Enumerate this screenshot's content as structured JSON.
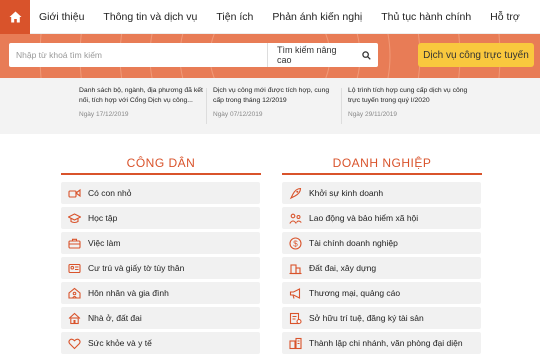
{
  "nav": {
    "items": [
      "Giới thiệu",
      "Thông tin và dịch vụ",
      "Tiện ích",
      "Phản ánh kiến nghị",
      "Thủ tục hành chính",
      "Hỗ trợ"
    ]
  },
  "search": {
    "placeholder": "Nhập từ khoá tìm kiếm",
    "advanced_label": "Tìm kiếm nâng cao",
    "cta_label": "Dịch vụ công trực tuyến"
  },
  "news": [
    {
      "title": "Danh sách bộ, ngành, địa phương đã kết nối, tích hợp với Cổng Dịch vụ công...",
      "date": "Ngày 17/12/2019"
    },
    {
      "title": "Dịch vụ công mới được tích hợp, cung cấp trong tháng 12/2019",
      "date": "Ngày 07/12/2019"
    },
    {
      "title": "Lộ trình tích hợp cung cấp dịch vụ công trực tuyến trong quý I/2020",
      "date": "Ngày 29/11/2019"
    }
  ],
  "sections": {
    "cong_dan": {
      "title": "CÔNG DÂN",
      "items": [
        {
          "label": "Có con nhỏ",
          "icon": "baby-icon"
        },
        {
          "label": "Học tập",
          "icon": "graduation-cap-icon"
        },
        {
          "label": "Việc làm",
          "icon": "briefcase-icon"
        },
        {
          "label": "Cư trú và giấy tờ tùy thân",
          "icon": "id-card-icon"
        },
        {
          "label": "Hôn nhân và gia đình",
          "icon": "family-icon"
        },
        {
          "label": "Nhà ở, đất đai",
          "icon": "house-icon"
        },
        {
          "label": "Sức khỏe và y tế",
          "icon": "health-icon"
        }
      ]
    },
    "doanh_nghiep": {
      "title": "DOANH NGHIỆP",
      "items": [
        {
          "label": "Khởi sự kinh doanh",
          "icon": "rocket-icon"
        },
        {
          "label": "Lao động và bảo hiểm xã hội",
          "icon": "workers-icon"
        },
        {
          "label": "Tài chính doanh nghiệp",
          "icon": "dollar-icon"
        },
        {
          "label": "Đất đai, xây dựng",
          "icon": "building-icon"
        },
        {
          "label": "Thương mại, quảng cáo",
          "icon": "megaphone-icon"
        },
        {
          "label": "Sở hữu trí tuệ, đăng ký tài sản",
          "icon": "certificate-icon"
        },
        {
          "label": "Thành lập chi nhánh, văn phòng đại diện",
          "icon": "branch-icon"
        }
      ]
    }
  },
  "colors": {
    "accent": "#d9532b",
    "banner": "#e87c56",
    "cta": "#f9c83e",
    "item_bg": "#f1f1f1"
  }
}
